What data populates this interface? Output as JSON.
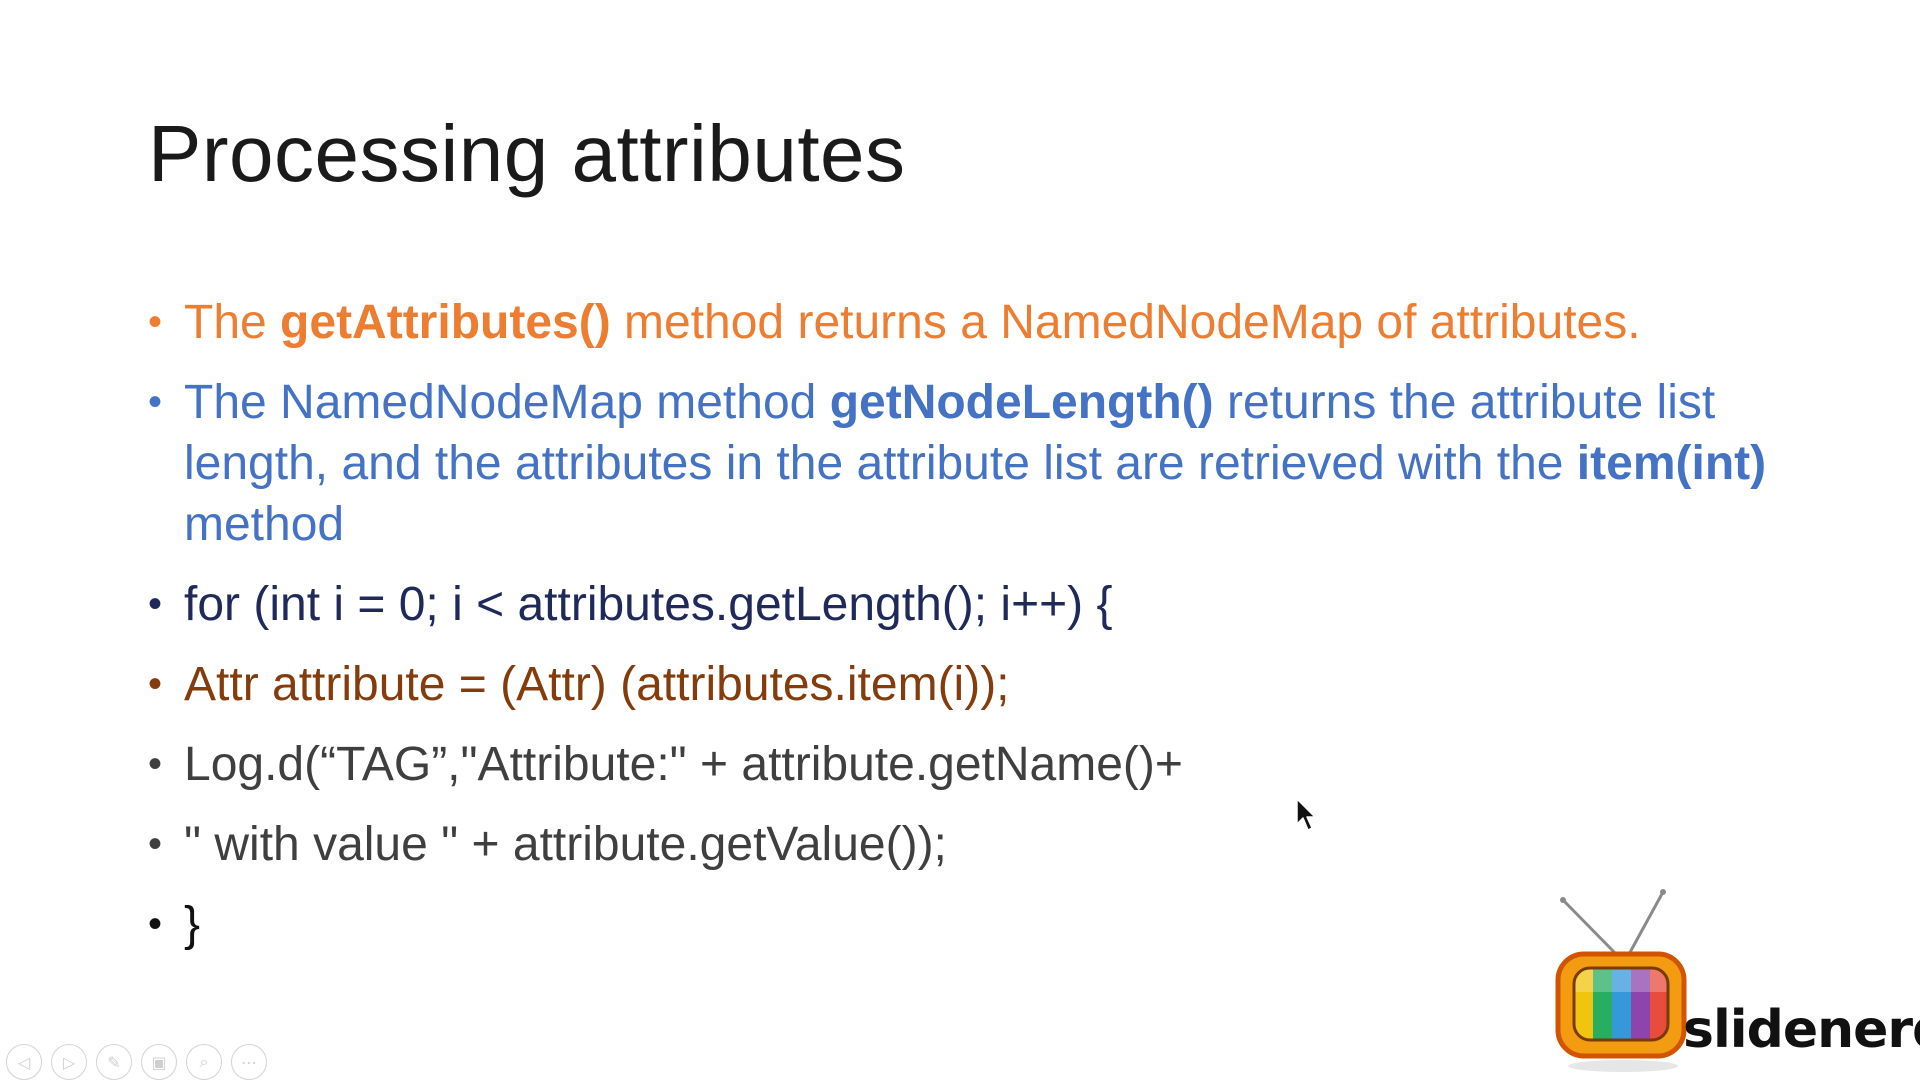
{
  "slide": {
    "title": "Processing attributes",
    "bullets": [
      {
        "color": "#ED7D31",
        "segments": [
          {
            "text": "The ",
            "bold": false
          },
          {
            "text": "getAttributes()",
            "bold": true
          },
          {
            "text": " method returns a NamedNodeMap of attributes.",
            "bold": false
          }
        ]
      },
      {
        "color": "#4472C4",
        "segments": [
          {
            "text": "The NamedNodeMap method ",
            "bold": false
          },
          {
            "text": "getNodeLength()",
            "bold": true
          },
          {
            "text": " returns the attribute list length, and the attributes in the attribute list are retrieved with the ",
            "bold": false
          },
          {
            "text": "item(int)",
            "bold": true
          },
          {
            "text": " method",
            "bold": false
          }
        ]
      },
      {
        "color": "#1F2A5A",
        "segments": [
          {
            "text": "for (int i = 0; i < attributes.getLength(); i++) {",
            "bold": false
          }
        ]
      },
      {
        "color": "#843C0C",
        "segments": [
          {
            "text": "Attr attribute = (Attr) (attributes.item(i));",
            "bold": false
          }
        ]
      },
      {
        "color": "#3F3F3F",
        "segments": [
          {
            "text": "Log.d(“TAG”,\"Attribute:\" + attribute.getName()+",
            "bold": false
          }
        ]
      },
      {
        "color": "#3F3F3F",
        "segments": [
          {
            "text": "\" with value \" + attribute.getValue());",
            "bold": false
          }
        ]
      },
      {
        "color": "#111111",
        "segments": [
          {
            "text": "}",
            "bold": false
          }
        ]
      }
    ]
  },
  "bullet_symbol": "•",
  "toolbar": {
    "buttons": [
      {
        "name": "previous-slide-button",
        "icon": "arrow-left-icon",
        "glyph": "◁"
      },
      {
        "name": "next-slide-button",
        "icon": "arrow-right-icon",
        "glyph": "▷"
      },
      {
        "name": "pen-tool-button",
        "icon": "pen-icon",
        "glyph": "✎"
      },
      {
        "name": "see-all-slides-button",
        "icon": "slides-grid-icon",
        "glyph": "▣"
      },
      {
        "name": "zoom-button",
        "icon": "magnifier-icon",
        "glyph": "⌕"
      },
      {
        "name": "more-options-button",
        "icon": "more-icon",
        "glyph": "⋯"
      }
    ]
  },
  "logo": {
    "wordmark": "slidenerd",
    "colors": {
      "tv_body": "#F39C12",
      "tv_outline": "#D35400",
      "screen_stripes": [
        "#F1C40F",
        "#27AE60",
        "#3498DB",
        "#8E44AD",
        "#E74C3C"
      ]
    }
  }
}
